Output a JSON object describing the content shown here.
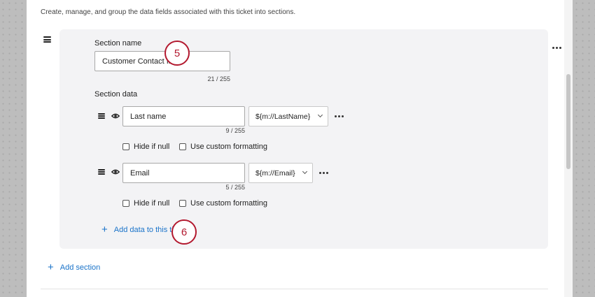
{
  "intro": "Create, manage, and group the data fields associated with this ticket into sections.",
  "section": {
    "name_label": "Section name",
    "name_value": "Customer Contact Info",
    "name_counter": "21 / 255",
    "data_label": "Section data"
  },
  "rows": [
    {
      "value": "Last name",
      "counter": "9 / 255",
      "select": "${m://LastName}",
      "hide_if_null": "Hide if null",
      "custom_formatting": "Use custom formatting"
    },
    {
      "value": "Email",
      "counter": "5 / 255",
      "select": "${m://Email}",
      "hide_if_null": "Hide if null",
      "custom_formatting": "Use custom formatting"
    }
  ],
  "add_data_label": "Add data to this ticket",
  "add_section_label": "Add section",
  "callouts": [
    "5",
    "6"
  ],
  "colors": {
    "accent": "#1a73c9",
    "callout": "#b3192f",
    "card": "#f3f3f5"
  }
}
